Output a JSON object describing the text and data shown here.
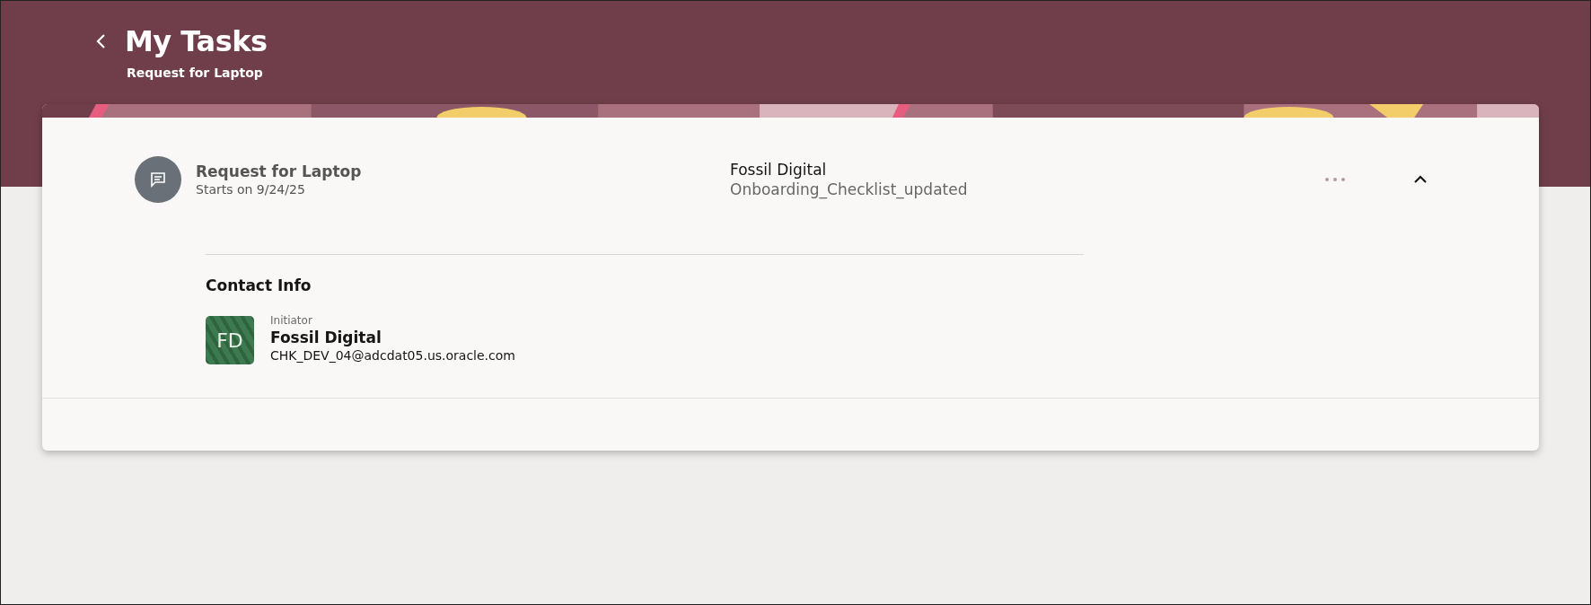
{
  "header": {
    "title": "My Tasks",
    "subtitle": "Request for Laptop"
  },
  "task": {
    "title": "Request for Laptop",
    "starts": "Starts on 9/24/25",
    "owner": "Fossil Digital",
    "checklist": "Onboarding_Checklist_updated",
    "expanded": true
  },
  "contact": {
    "heading": "Contact Info",
    "role": "Initiator",
    "initials": "FD",
    "name": "Fossil Digital",
    "email": "CHK_DEV_04@adcdat05.us.oracle.com"
  }
}
